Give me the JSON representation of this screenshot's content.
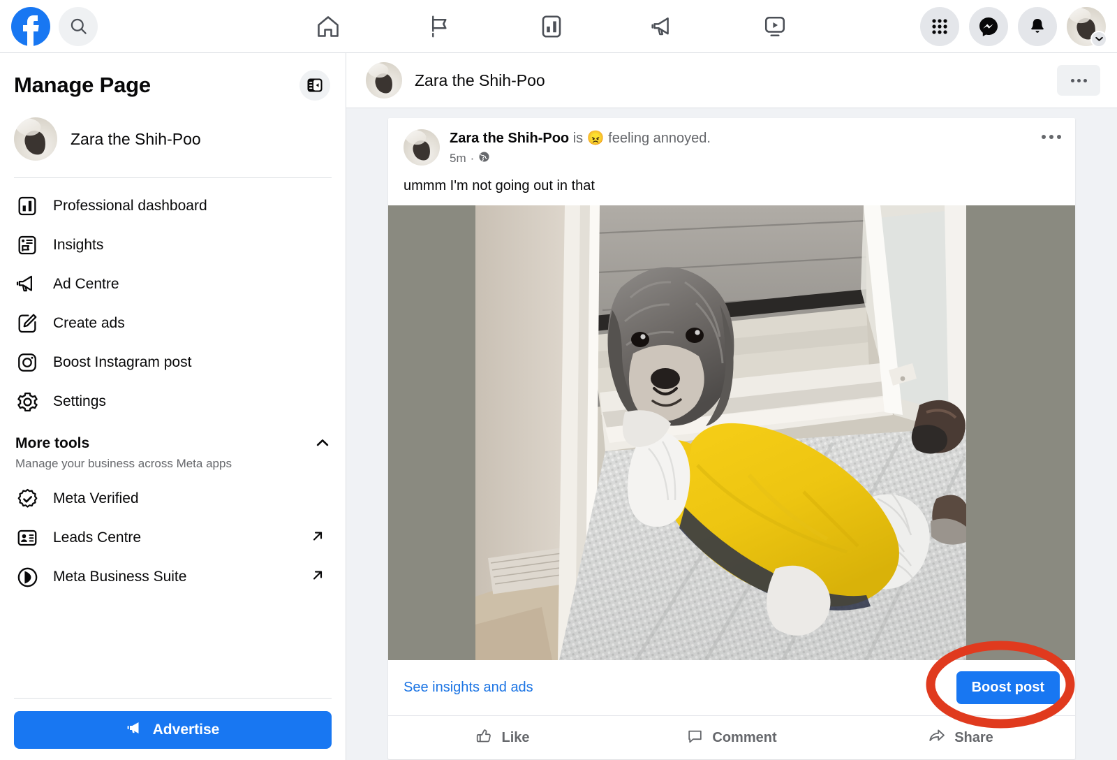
{
  "topbar": {
    "logo": "facebook-logo",
    "search_placeholder": "Search Facebook",
    "nav_tabs": [
      {
        "name": "home-tab",
        "icon": "home-icon"
      },
      {
        "name": "pages-tab",
        "icon": "flag-icon"
      },
      {
        "name": "insights-tab",
        "icon": "bar-chart-icon"
      },
      {
        "name": "ads-tab",
        "icon": "megaphone-icon"
      },
      {
        "name": "video-tab",
        "icon": "video-icon"
      }
    ],
    "right_actions": [
      {
        "name": "menu-grid-button",
        "icon": "grid-icon"
      },
      {
        "name": "messenger-button",
        "icon": "messenger-icon"
      },
      {
        "name": "notifications-button",
        "icon": "bell-icon"
      },
      {
        "name": "account-button",
        "icon": "avatar-chevron-icon"
      }
    ]
  },
  "sidebar": {
    "title": "Manage Page",
    "collapse_icon": "sidebar-collapse-icon",
    "page_name": "Zara the Shih-Poo",
    "items": [
      {
        "label": "Professional dashboard",
        "icon": "bar-chart-icon",
        "external": false
      },
      {
        "label": "Insights",
        "icon": "insights-flag-icon",
        "external": false
      },
      {
        "label": "Ad Centre",
        "icon": "megaphone-icon",
        "external": false
      },
      {
        "label": "Create ads",
        "icon": "pencil-square-icon",
        "external": false
      },
      {
        "label": "Boost Instagram post",
        "icon": "instagram-icon",
        "external": false
      },
      {
        "label": "Settings",
        "icon": "gear-icon",
        "external": false
      }
    ],
    "more_tools": {
      "title": "More tools",
      "subtitle": "Manage your business across Meta apps",
      "chevron": "chevron-up-icon",
      "items": [
        {
          "label": "Meta Verified",
          "icon": "verified-badge-icon",
          "external": false
        },
        {
          "label": "Leads Centre",
          "icon": "contact-card-icon",
          "external": true
        },
        {
          "label": "Meta Business Suite",
          "icon": "meta-business-icon",
          "external": true
        }
      ]
    },
    "advertise_label": "Advertise",
    "advertise_icon": "megaphone-filled-icon"
  },
  "main": {
    "page_header": {
      "page_name": "Zara the Shih-Poo",
      "more_icon": "more-horizontal-icon"
    },
    "post": {
      "author": "Zara the Shih-Poo",
      "feeling_connector": "is",
      "feeling_emoji": "😠",
      "feeling_text": "feeling annoyed.",
      "timestamp": "5m",
      "separator": "·",
      "privacy_icon": "globe-icon",
      "more_icon": "more-horizontal-icon",
      "text": "ummm I'm not going out in that",
      "photo_alt": "Shih-Poo dog in yellow raincoat standing on grey rug by open door with wet deck outside",
      "insights_link": "See insights and ads",
      "boost_label": "Boost post",
      "actions": [
        {
          "label": "Like",
          "icon": "thumbs-up-icon"
        },
        {
          "label": "Comment",
          "icon": "comment-bubble-icon"
        },
        {
          "label": "Share",
          "icon": "share-arrow-icon"
        }
      ]
    }
  },
  "annotation": {
    "shape": "ellipse",
    "color": "#e03a1e",
    "target": "boost-post-button"
  },
  "colors": {
    "brand_blue": "#1877f2",
    "link_blue": "#1b74e4",
    "bg_grey": "#f0f2f5",
    "text_primary": "#080809",
    "text_secondary": "#65676b",
    "annotation_red": "#e03a1e"
  }
}
